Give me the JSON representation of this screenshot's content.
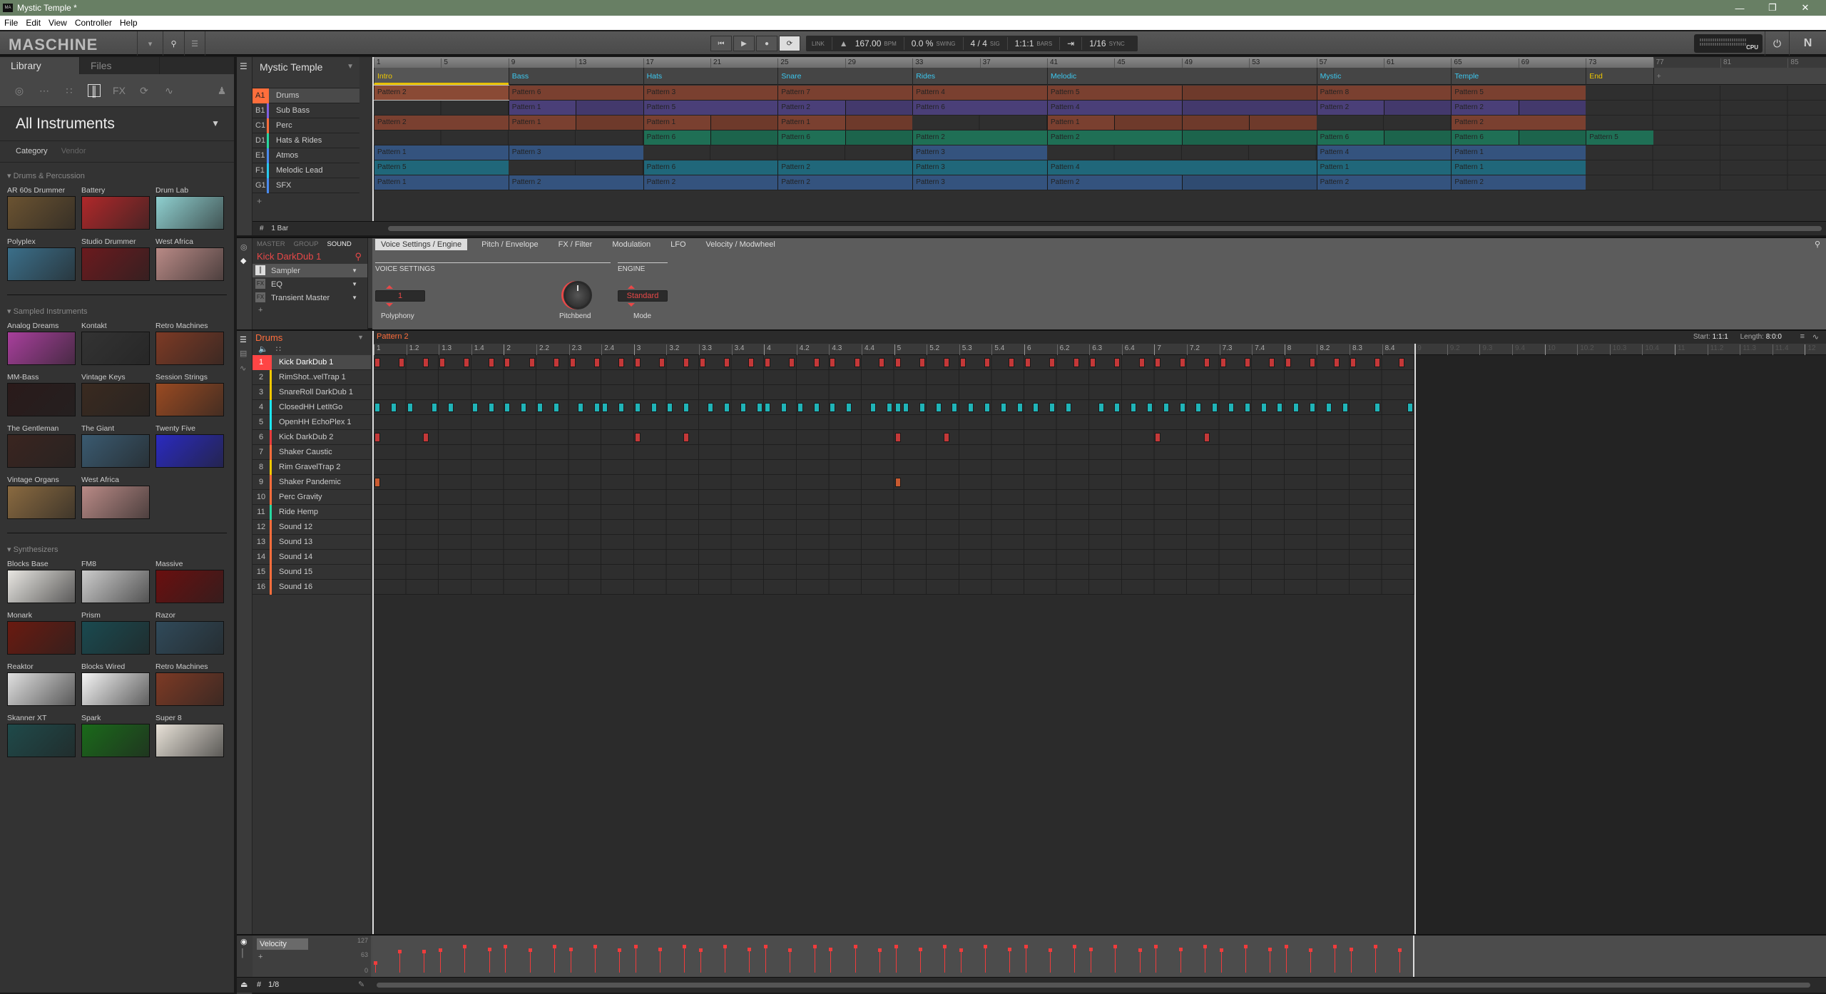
{
  "window": {
    "title": "Mystic Temple *",
    "controls": [
      "minimize",
      "maximize",
      "close"
    ]
  },
  "menu": [
    "File",
    "Edit",
    "View",
    "Controller",
    "Help"
  ],
  "header": {
    "logo": "MASCHINE",
    "transport": {
      "link": "LINK",
      "tempo": "167.00",
      "tempo_unit": "BPM",
      "swing": "0.0 %",
      "swing_label": "SWING",
      "signature": "4 / 4",
      "sig_label": "SIG",
      "position": "1:1:1",
      "position_label": "BARS",
      "sync": "1/16",
      "sync_label": "SYNC"
    },
    "cpu_label": "CPU"
  },
  "library": {
    "tabs": [
      "Library",
      "Files"
    ],
    "active_tab": "Library",
    "title": "All Instruments",
    "filters": [
      "Category",
      "Vendor"
    ],
    "sections": [
      {
        "name": "Drums & Percussion",
        "items": [
          {
            "name": "AR 60s Drummer",
            "color": "#6b5331"
          },
          {
            "name": "Battery",
            "color": "#b0282a"
          },
          {
            "name": "Drum Lab",
            "color": "#8fd0d0"
          },
          {
            "name": "Polyplex",
            "color": "#3b6f8a"
          },
          {
            "name": "Studio Drummer",
            "color": "#6b1a1e"
          },
          {
            "name": "West Africa",
            "color": "#b98a86"
          }
        ]
      },
      {
        "name": "Sampled Instruments",
        "items": [
          {
            "name": "Analog Dreams",
            "color": "#a83f9c"
          },
          {
            "name": "Kontakt",
            "color": "#333333"
          },
          {
            "name": "Retro Machines",
            "color": "#7d3a25"
          },
          {
            "name": "MM-Bass",
            "color": "#2a1a1a"
          },
          {
            "name": "Vintage Keys",
            "color": "#3a2a20"
          },
          {
            "name": "Session Strings",
            "color": "#9a4a22"
          },
          {
            "name": "The Gentleman",
            "color": "#3a2520"
          },
          {
            "name": "The Giant",
            "color": "#3a5a70"
          },
          {
            "name": "Twenty Five",
            "color": "#2a2ac0"
          },
          {
            "name": "Vintage Organs",
            "color": "#8a6a40"
          },
          {
            "name": "West Africa",
            "color": "#b98a86"
          }
        ]
      },
      {
        "name": "Synthesizers",
        "items": [
          {
            "name": "Blocks Base",
            "color": "#e8e6e2"
          },
          {
            "name": "FM8",
            "color": "#cccccc"
          },
          {
            "name": "Massive",
            "color": "#6a0f0f"
          },
          {
            "name": "Monark",
            "color": "#6a1a10"
          },
          {
            "name": "Prism",
            "color": "#1a4a50"
          },
          {
            "name": "Razor",
            "color": "#304a5a"
          },
          {
            "name": "Reaktor",
            "color": "#e0e0e0"
          },
          {
            "name": "Blocks Wired",
            "color": "#f4f4f4"
          },
          {
            "name": "Retro Machines",
            "color": "#7d3a25"
          },
          {
            "name": "Skanner XT",
            "color": "#1f4a4a"
          },
          {
            "name": "Spark",
            "color": "#1a6a1a"
          },
          {
            "name": "Super 8",
            "color": "#e8e2d8"
          }
        ]
      }
    ]
  },
  "arranger": {
    "project": "Mystic Temple",
    "bar_markers": [
      "1",
      "5",
      "9",
      "13",
      "17",
      "21",
      "25",
      "29",
      "33",
      "37",
      "41",
      "45",
      "49",
      "53",
      "57",
      "61",
      "65",
      "69",
      "73",
      "77",
      "81",
      "85"
    ],
    "scenes": [
      {
        "name": "Intro",
        "start": 1,
        "length": 8,
        "color": "#f0c800"
      },
      {
        "name": "Bass",
        "start": 9,
        "length": 8,
        "color": "#3cc8f0"
      },
      {
        "name": "Hats",
        "start": 17,
        "length": 8,
        "color": "#3cc8f0"
      },
      {
        "name": "Snare",
        "start": 25,
        "length": 8,
        "color": "#3cc8f0"
      },
      {
        "name": "Rides",
        "start": 33,
        "length": 8,
        "color": "#3cc8f0"
      },
      {
        "name": "Melodic",
        "start": 41,
        "length": 16,
        "color": "#3cc8f0"
      },
      {
        "name": "Mystic",
        "start": 57,
        "length": 8,
        "color": "#3cc8f0"
      },
      {
        "name": "Temple",
        "start": 65,
        "length": 8,
        "color": "#3cc8f0"
      },
      {
        "name": "End",
        "start": 73,
        "length": 4,
        "color": "#f0c800"
      }
    ],
    "groups": [
      {
        "id": "A1",
        "name": "Drums",
        "color": "#ff6e3c",
        "clip_color": "#7a4030",
        "clips": [
          {
            "label": "Pattern 2",
            "start": 1,
            "length": 8
          },
          {
            "label": "Pattern 6",
            "start": 9,
            "length": 8
          },
          {
            "label": "Pattern 3",
            "start": 17,
            "length": 8
          },
          {
            "label": "Pattern 7",
            "start": 25,
            "length": 8
          },
          {
            "label": "Pattern 4",
            "start": 33,
            "length": 8
          },
          {
            "label": "Pattern 5",
            "start": 41,
            "length": 8
          },
          {
            "label": "",
            "start": 49,
            "length": 8
          },
          {
            "label": "Pattern 8",
            "start": 57,
            "length": 8
          },
          {
            "label": "Pattern 5",
            "start": 65,
            "length": 8
          }
        ]
      },
      {
        "id": "B1",
        "name": "Sub Bass",
        "color": "#8060e0",
        "clip_color": "#4a3f78",
        "clips": [
          {
            "label": "Pattern 1",
            "start": 9,
            "length": 4
          },
          {
            "label": "",
            "start": 13,
            "length": 4
          },
          {
            "label": "Pattern 5",
            "start": 17,
            "length": 8
          },
          {
            "label": "Pattern 2",
            "start": 25,
            "length": 4
          },
          {
            "label": "",
            "start": 29,
            "length": 4
          },
          {
            "label": "Pattern 6",
            "start": 33,
            "length": 8
          },
          {
            "label": "Pattern 4",
            "start": 41,
            "length": 8
          },
          {
            "label": "",
            "start": 49,
            "length": 8
          },
          {
            "label": "Pattern 2",
            "start": 57,
            "length": 4
          },
          {
            "label": "",
            "start": 61,
            "length": 4
          },
          {
            "label": "Pattern 2",
            "start": 65,
            "length": 4
          },
          {
            "label": "",
            "start": 69,
            "length": 4
          }
        ]
      },
      {
        "id": "C1",
        "name": "Perc",
        "color": "#ff6e3c",
        "clip_color": "#7a4030",
        "clips": [
          {
            "label": "Pattern 2",
            "start": 1,
            "length": 8
          },
          {
            "label": "Pattern 1",
            "start": 9,
            "length": 4
          },
          {
            "label": "",
            "start": 13,
            "length": 4
          },
          {
            "label": "Pattern 1",
            "start": 17,
            "length": 4
          },
          {
            "label": "",
            "start": 21,
            "length": 4
          },
          {
            "label": "Pattern 1",
            "start": 25,
            "length": 4
          },
          {
            "label": "",
            "start": 29,
            "length": 4
          },
          {
            "label": "Pattern 1",
            "start": 41,
            "length": 4
          },
          {
            "label": "",
            "start": 45,
            "length": 4
          },
          {
            "label": "",
            "start": 49,
            "length": 4
          },
          {
            "label": "",
            "start": 53,
            "length": 4
          },
          {
            "label": "Pattern 2",
            "start": 65,
            "length": 8
          }
        ]
      },
      {
        "id": "D1",
        "name": "Hats & Rides",
        "color": "#28d7a0",
        "clip_color": "#1f6f55",
        "clips": [
          {
            "label": "Pattern 6",
            "start": 17,
            "length": 4
          },
          {
            "label": "",
            "start": 21,
            "length": 4
          },
          {
            "label": "Pattern 6",
            "start": 25,
            "length": 4
          },
          {
            "label": "",
            "start": 29,
            "length": 4
          },
          {
            "label": "Pattern 2",
            "start": 33,
            "length": 8
          },
          {
            "label": "Pattern 2",
            "start": 41,
            "length": 8
          },
          {
            "label": "",
            "start": 49,
            "length": 8
          },
          {
            "label": "Pattern 6",
            "start": 57,
            "length": 4
          },
          {
            "label": "",
            "start": 61,
            "length": 4
          },
          {
            "label": "Pattern 6",
            "start": 65,
            "length": 4
          },
          {
            "label": "",
            "start": 69,
            "length": 4
          },
          {
            "label": "Pattern 5",
            "start": 73,
            "length": 4
          }
        ]
      },
      {
        "id": "E1",
        "name": "Atmos",
        "color": "#4a8cf0",
        "clip_color": "#34537e",
        "clips": [
          {
            "label": "Pattern 1",
            "start": 1,
            "length": 8
          },
          {
            "label": "Pattern 3",
            "start": 9,
            "length": 8
          },
          {
            "label": "Pattern 3",
            "start": 33,
            "length": 8
          },
          {
            "label": "Pattern 4",
            "start": 57,
            "length": 8
          },
          {
            "label": "Pattern 1",
            "start": 65,
            "length": 8
          }
        ]
      },
      {
        "id": "F1",
        "name": "Melodic Lead",
        "color": "#28c8f0",
        "clip_color": "#20677a",
        "clips": [
          {
            "label": "Pattern 5",
            "start": 1,
            "length": 8
          },
          {
            "label": "Pattern 6",
            "start": 17,
            "length": 8
          },
          {
            "label": "Pattern 2",
            "start": 25,
            "length": 8
          },
          {
            "label": "Pattern 3",
            "start": 33,
            "length": 8
          },
          {
            "label": "Pattern 4",
            "start": 41,
            "length": 16
          },
          {
            "label": "Pattern 1",
            "start": 57,
            "length": 8
          },
          {
            "label": "Pattern 1",
            "start": 65,
            "length": 8
          }
        ]
      },
      {
        "id": "G1",
        "name": "SFX",
        "color": "#4a8cf0",
        "clip_color": "#34537e",
        "clips": [
          {
            "label": "Pattern 1",
            "start": 1,
            "length": 8
          },
          {
            "label": "Pattern 2",
            "start": 9,
            "length": 8
          },
          {
            "label": "Pattern 2",
            "start": 17,
            "length": 8
          },
          {
            "label": "Pattern 2",
            "start": 25,
            "length": 8
          },
          {
            "label": "Pattern 3",
            "start": 33,
            "length": 8
          },
          {
            "label": "Pattern 2",
            "start": 41,
            "length": 8
          },
          {
            "label": "",
            "start": 49,
            "length": 8
          },
          {
            "label": "Pattern 2",
            "start": 57,
            "length": 8
          },
          {
            "label": "Pattern 2",
            "start": 65,
            "length": 8
          }
        ]
      }
    ],
    "grid_label": "1 Bar"
  },
  "sound_module": {
    "tabs": [
      "MASTER",
      "GROUP",
      "SOUND"
    ],
    "active_tab": "SOUND",
    "sound_name": "Kick DarkDub 1",
    "plugins": [
      {
        "name": "Sampler",
        "type": "instrument"
      },
      {
        "name": "EQ",
        "type": "fx"
      },
      {
        "name": "Transient Master",
        "type": "fx"
      }
    ],
    "page_tabs": [
      "Voice Settings / Engine",
      "Pitch / Envelope",
      "FX / Filter",
      "Modulation",
      "LFO",
      "Velocity / Modwheel"
    ],
    "active_page": "Voice Settings / Engine",
    "sections": {
      "voice": "VOICE SETTINGS",
      "engine": "ENGINE"
    },
    "params": {
      "polyphony": {
        "label": "Polyphony",
        "value": "1"
      },
      "pitchbend": {
        "label": "Pitchbend"
      },
      "mode": {
        "label": "Mode",
        "value": "Standard"
      }
    }
  },
  "pattern_editor": {
    "group": "Drums",
    "pattern": "Pattern 2",
    "start_label": "Start:",
    "start": "1:1:1",
    "length_label": "Length:",
    "length": "8:0:0",
    "ruler": [
      "1",
      "1.2",
      "1.3",
      "1.4",
      "2",
      "2.2",
      "2.3",
      "2.4",
      "3",
      "3.2",
      "3.3",
      "3.4",
      "4",
      "4.2",
      "4.3",
      "4.4",
      "5",
      "5.2",
      "5.3",
      "5.4",
      "6",
      "6.2",
      "6.3",
      "6.4",
      "7",
      "7.2",
      "7.3",
      "7.4",
      "8",
      "8.2",
      "8.3",
      "8.4",
      "9",
      "9.2",
      "9.3",
      "9.4",
      "10",
      "10.2",
      "10.3",
      "10.4",
      "11",
      "11.2",
      "11.3",
      "11.4",
      "12"
    ],
    "pattern_bars": 8,
    "sounds": [
      {
        "n": "1",
        "name": "Kick DarkDub 1",
        "color": "#ff4545",
        "note_color": "#c43838",
        "steps": [
          0,
          3,
          6,
          8,
          11,
          14,
          16,
          19,
          22,
          24,
          27,
          30,
          32,
          35,
          38,
          40,
          43,
          46,
          48,
          51,
          54,
          56,
          59,
          62,
          64,
          67,
          70,
          72,
          75,
          78,
          80,
          83,
          86,
          88,
          91,
          94,
          96,
          99,
          102,
          104,
          107,
          110,
          112,
          115,
          118,
          120,
          123,
          126
        ]
      },
      {
        "n": "2",
        "name": "RimShot..velTrap 1",
        "color": "#f0c800",
        "steps": []
      },
      {
        "n": "3",
        "name": "SnareRoll DarkDub 1",
        "color": "#f0c800",
        "steps": []
      },
      {
        "n": "4",
        "name": "ClosedHH LetItGo",
        "color": "#1ee6f0",
        "note_color": "#20b4b8",
        "steps": [
          0,
          2,
          4,
          7,
          9,
          12,
          14,
          16,
          18,
          20,
          22,
          25,
          27,
          28,
          30,
          32,
          34,
          36,
          38,
          41,
          43,
          45,
          47,
          48,
          50,
          52,
          54,
          56,
          58,
          61,
          63,
          64,
          65,
          67,
          69,
          71,
          73,
          75,
          77,
          79,
          81,
          83,
          85,
          89,
          91,
          93,
          95,
          97,
          99,
          101,
          103,
          105,
          107,
          109,
          111,
          113,
          115,
          117,
          119,
          123,
          127
        ]
      },
      {
        "n": "5",
        "name": "OpenHH EchoPlex 1",
        "color": "#1ee6f0",
        "steps": []
      },
      {
        "n": "6",
        "name": "Kick DarkDub 2",
        "color": "#e83c3c",
        "note_color": "#c43838",
        "steps": [
          0,
          6,
          32,
          38,
          64,
          70,
          96,
          102
        ]
      },
      {
        "n": "7",
        "name": "Shaker Caustic",
        "color": "#ff6e3c",
        "steps": []
      },
      {
        "n": "8",
        "name": "Rim GravelTrap 2",
        "color": "#f0c800",
        "steps": []
      },
      {
        "n": "9",
        "name": "Shaker Pandemic",
        "color": "#ff6e3c",
        "note_color": "#c85a30",
        "steps": [
          0,
          64
        ]
      },
      {
        "n": "10",
        "name": "Perc Gravity",
        "color": "#ff6e3c",
        "steps": []
      },
      {
        "n": "11",
        "name": "Ride Hemp",
        "color": "#28d7a0",
        "steps": []
      },
      {
        "n": "12",
        "name": "Sound 12",
        "color": "#ff6e3c",
        "steps": []
      },
      {
        "n": "13",
        "name": "Sound 13",
        "color": "#ff6e3c",
        "steps": []
      },
      {
        "n": "14",
        "name": "Sound 14",
        "color": "#ff6e3c",
        "steps": []
      },
      {
        "n": "15",
        "name": "Sound 15",
        "color": "#ff6e3c",
        "steps": []
      },
      {
        "n": "16",
        "name": "Sound 16",
        "color": "#ff6e3c",
        "steps": []
      }
    ],
    "velocity": {
      "label": "Velocity",
      "scale": [
        "127",
        "63",
        "0"
      ],
      "values_percent": [
        30,
        65,
        65,
        70,
        80,
        72,
        80,
        70,
        80,
        72,
        80,
        70,
        80,
        72,
        80,
        70,
        80,
        72,
        80,
        70,
        80,
        72,
        80,
        70,
        80,
        72,
        80,
        70,
        80,
        72,
        80,
        70,
        80,
        72,
        80,
        70,
        80,
        72,
        80,
        70,
        80,
        72,
        80,
        70,
        80,
        72,
        80,
        70
      ]
    },
    "footer": {
      "grid": "1/8"
    }
  }
}
